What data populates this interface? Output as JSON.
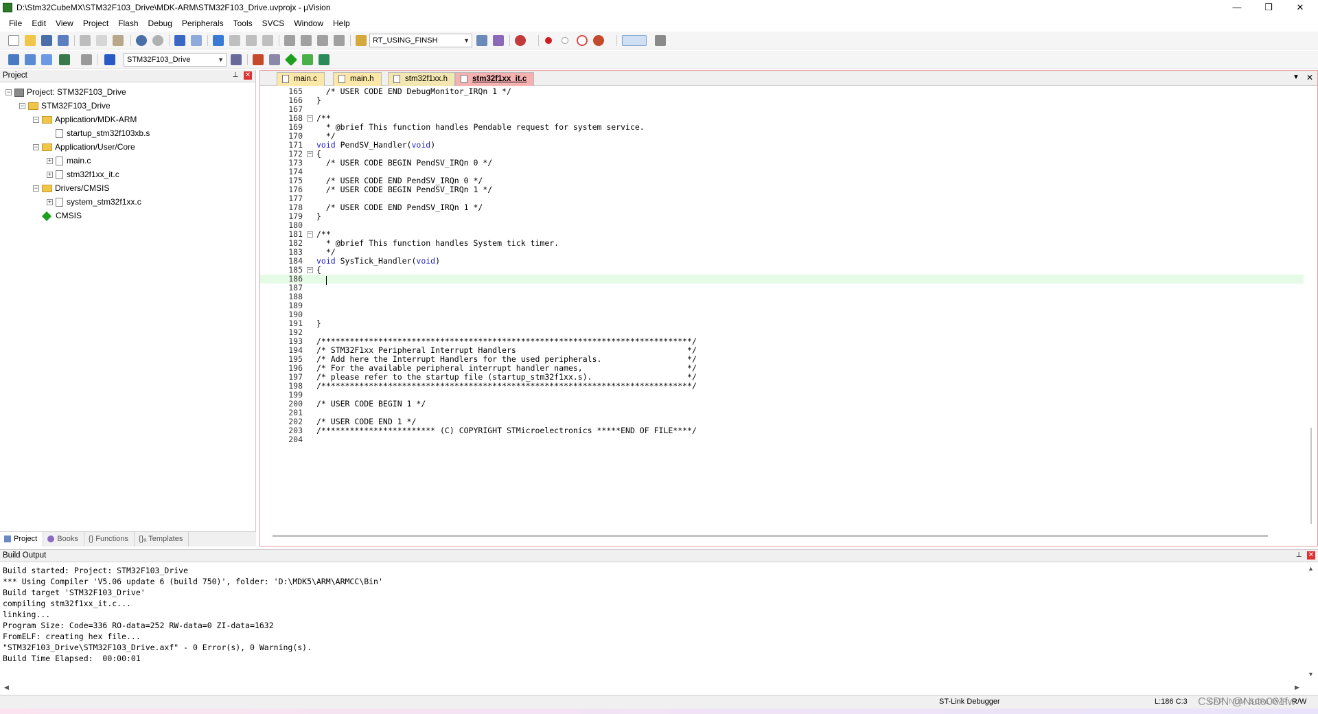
{
  "window": {
    "title": "D:\\Stm32CubeMX\\STM32F103_Drive\\MDK-ARM\\STM32F103_Drive.uvprojx - µVision",
    "minimize": "—",
    "maximize": "❒",
    "close": "✕"
  },
  "menu": [
    "File",
    "Edit",
    "View",
    "Project",
    "Flash",
    "Debug",
    "Peripherals",
    "Tools",
    "SVCS",
    "Window",
    "Help"
  ],
  "toolbar": {
    "search_combo": "RT_USING_FINSH",
    "target_combo": "STM32F103_Drive"
  },
  "project_panel": {
    "title": "Project",
    "pin": "✕",
    "tree": [
      {
        "label": "Project: STM32F103_Drive",
        "icon": "project-icon",
        "expander": "−",
        "depth": 0
      },
      {
        "label": "STM32F103_Drive",
        "icon": "folder-icon",
        "expander": "−",
        "depth": 1
      },
      {
        "label": "Application/MDK-ARM",
        "icon": "folder-icon",
        "expander": "−",
        "depth": 2
      },
      {
        "label": "startup_stm32f103xb.s",
        "icon": "file-icon",
        "expander": "",
        "depth": 3
      },
      {
        "label": "Application/User/Core",
        "icon": "folder-icon",
        "expander": "−",
        "depth": 2
      },
      {
        "label": "main.c",
        "icon": "file-icon",
        "expander": "+",
        "depth": 3
      },
      {
        "label": "stm32f1xx_it.c",
        "icon": "file-icon",
        "expander": "+",
        "depth": 3
      },
      {
        "label": "Drivers/CMSIS",
        "icon": "folder-icon",
        "expander": "−",
        "depth": 2
      },
      {
        "label": "system_stm32f1xx.c",
        "icon": "file-icon",
        "expander": "+",
        "depth": 3
      },
      {
        "label": "CMSIS",
        "icon": "diamond-icon",
        "expander": "",
        "depth": 2
      }
    ],
    "tabs": [
      "Project",
      "Books",
      "{} Functions",
      "{}ₐ Templates"
    ]
  },
  "editor": {
    "tabs": [
      {
        "label": "main.c",
        "active": false
      },
      {
        "label": "main.h",
        "active": false
      },
      {
        "label": "stm32f1xx.h",
        "active": false
      },
      {
        "label": "stm32f1xx_it.c",
        "active": true
      }
    ],
    "dropdown": "▼",
    "close": "✕",
    "current_line": 186,
    "lines": [
      {
        "n": "165",
        "fold": "",
        "text": "  /* USER CODE END DebugMonitor_IRQn 1 */",
        "cls": "cm"
      },
      {
        "n": "166",
        "fold": "",
        "text": "}",
        "cls": ""
      },
      {
        "n": "167",
        "fold": "",
        "text": "",
        "cls": ""
      },
      {
        "n": "168",
        "fold": "−",
        "text": "/**",
        "cls": "cm"
      },
      {
        "n": "169",
        "fold": "",
        "text": "  * @brief This function handles Pendable request for system service.",
        "cls": "cm"
      },
      {
        "n": "170",
        "fold": "",
        "text": "  */",
        "cls": "cm"
      },
      {
        "n": "171",
        "fold": "",
        "text": "void PendSV_Handler(void)",
        "cls": "fn"
      },
      {
        "n": "172",
        "fold": "−",
        "text": "{",
        "cls": ""
      },
      {
        "n": "173",
        "fold": "",
        "text": "  /* USER CODE BEGIN PendSV_IRQn 0 */",
        "cls": "cm"
      },
      {
        "n": "174",
        "fold": "",
        "text": "",
        "cls": ""
      },
      {
        "n": "175",
        "fold": "",
        "text": "  /* USER CODE END PendSV_IRQn 0 */",
        "cls": "cm"
      },
      {
        "n": "176",
        "fold": "",
        "text": "  /* USER CODE BEGIN PendSV_IRQn 1 */",
        "cls": "cm"
      },
      {
        "n": "177",
        "fold": "",
        "text": "",
        "cls": ""
      },
      {
        "n": "178",
        "fold": "",
        "text": "  /* USER CODE END PendSV_IRQn 1 */",
        "cls": "cm"
      },
      {
        "n": "179",
        "fold": "",
        "text": "}",
        "cls": ""
      },
      {
        "n": "180",
        "fold": "",
        "text": "",
        "cls": ""
      },
      {
        "n": "181",
        "fold": "−",
        "text": "/**",
        "cls": "cm"
      },
      {
        "n": "182",
        "fold": "",
        "text": "  * @brief This function handles System tick timer.",
        "cls": "cm"
      },
      {
        "n": "183",
        "fold": "",
        "text": "  */",
        "cls": "cm"
      },
      {
        "n": "184",
        "fold": "",
        "text": "void SysTick_Handler(void)",
        "cls": "fn"
      },
      {
        "n": "185",
        "fold": "−",
        "text": "{",
        "cls": ""
      },
      {
        "n": "186",
        "fold": "",
        "text": "",
        "cls": ""
      },
      {
        "n": "187",
        "fold": "",
        "text": "",
        "cls": ""
      },
      {
        "n": "188",
        "fold": "",
        "text": "",
        "cls": ""
      },
      {
        "n": "189",
        "fold": "",
        "text": "",
        "cls": ""
      },
      {
        "n": "190",
        "fold": "",
        "text": "",
        "cls": ""
      },
      {
        "n": "191",
        "fold": "",
        "text": "}",
        "cls": ""
      },
      {
        "n": "192",
        "fold": "",
        "text": "",
        "cls": ""
      },
      {
        "n": "193",
        "fold": "",
        "text": "/******************************************************************************/",
        "cls": "cm"
      },
      {
        "n": "194",
        "fold": "",
        "text": "/* STM32F1xx Peripheral Interrupt Handlers                                    */",
        "cls": "cm"
      },
      {
        "n": "195",
        "fold": "",
        "text": "/* Add here the Interrupt Handlers for the used peripherals.                  */",
        "cls": "cm"
      },
      {
        "n": "196",
        "fold": "",
        "text": "/* For the available peripheral interrupt handler names,                      */",
        "cls": "cm"
      },
      {
        "n": "197",
        "fold": "",
        "text": "/* please refer to the startup file (startup_stm32f1xx.s).                    */",
        "cls": "cm"
      },
      {
        "n": "198",
        "fold": "",
        "text": "/******************************************************************************/",
        "cls": "cm"
      },
      {
        "n": "199",
        "fold": "",
        "text": "",
        "cls": ""
      },
      {
        "n": "200",
        "fold": "",
        "text": "/* USER CODE BEGIN 1 */",
        "cls": "cm"
      },
      {
        "n": "201",
        "fold": "",
        "text": "",
        "cls": ""
      },
      {
        "n": "202",
        "fold": "",
        "text": "/* USER CODE END 1 */",
        "cls": "cm"
      },
      {
        "n": "203",
        "fold": "",
        "text": "/************************ (C) COPYRIGHT STMicroelectronics *****END OF FILE****/",
        "cls": "cm"
      },
      {
        "n": "204",
        "fold": "",
        "text": "",
        "cls": ""
      }
    ]
  },
  "build_output": {
    "title": "Build Output",
    "pin": "✕",
    "text": "Build started: Project: STM32F103_Drive\n*** Using Compiler 'V5.06 update 6 (build 750)', folder: 'D:\\MDK5\\ARM\\ARMCC\\Bin'\nBuild target 'STM32F103_Drive'\ncompiling stm32f1xx_it.c...\nlinking...\nProgram Size: Code=336 RO-data=252 RW-data=0 ZI-data=1632\nFromELF: creating hex file...\n\"STM32F103_Drive\\STM32F103_Drive.axf\" - 0 Error(s), 0 Warning(s).\nBuild Time Elapsed:  00:00:01",
    "scroll_up": "▲",
    "scroll_down": "▼",
    "scroll_left": "◀",
    "scroll_right": "▶"
  },
  "status": {
    "debugger": "ST-Link Debugger",
    "position": "L:186 C:3",
    "caps": "CAP",
    "num": "NUM",
    "scrl": "SCRL",
    "ovr": "OVR",
    "rw": "R/W"
  },
  "watermark": "CSDN @Nuto061fw",
  "colors": {
    "comment": "#1a9a1a",
    "keyword": "#1e1ec8",
    "current_line": "#e6fbe6",
    "active_tab": "#f5b0b0",
    "file_tab": "#fbe8a8"
  }
}
